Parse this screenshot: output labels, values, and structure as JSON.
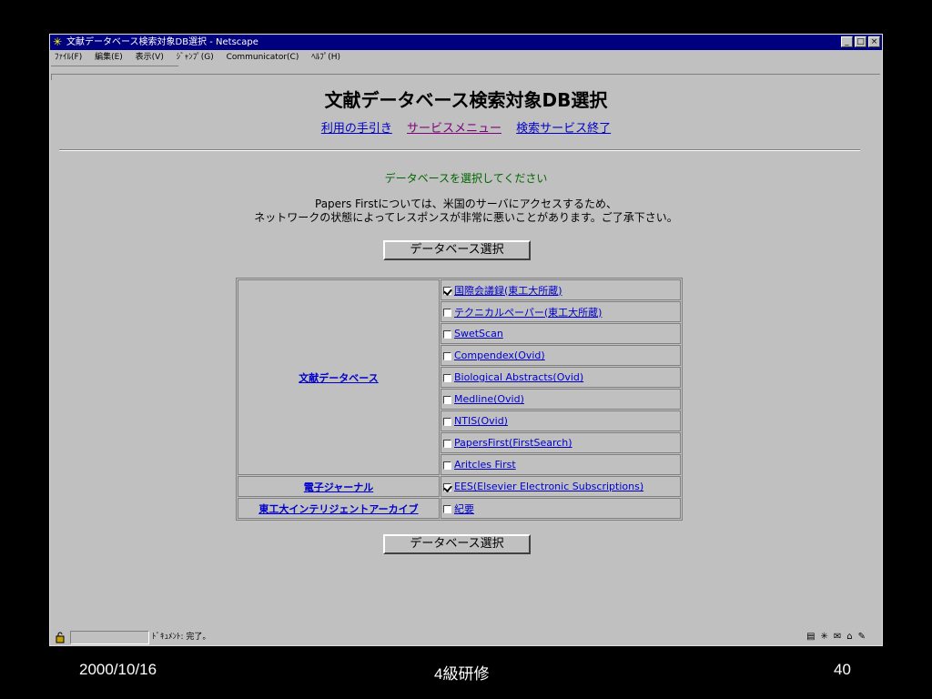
{
  "window": {
    "title": "文献データベース検索対象DB選択 - Netscape",
    "buttons": [
      "_",
      "□",
      "×"
    ]
  },
  "menu": [
    "ﾌｧｲﾙ(F)",
    "編集(E)",
    "表示(V)",
    "ｼﾞｬﾝﾌﾟ(G)",
    "Communicator(C)",
    "ﾍﾙﾌﾟ(H)"
  ],
  "page": {
    "heading": "文献データベース検索対象DB選択",
    "links": [
      "利用の手引き",
      "サービスメニュー",
      "検索サービス終了"
    ],
    "prompt": "データベースを選択してください",
    "notice_line1": "Papers Firstについては、米国のサーバにアクセスするため、",
    "notice_line2": "ネットワークの状態によってレスポンスが非常に悪いことがあります。ご了承下さい。",
    "select_button": "データベース選択"
  },
  "table": {
    "categories": [
      "文献データベース",
      "電子ジャーナル",
      "東工大インテリジェントアーカイブ"
    ],
    "options": [
      {
        "label": "国際会議録(東工大所蔵)",
        "checked": true
      },
      {
        "label": "テクニカルペーパー(東工大所蔵)",
        "checked": false
      },
      {
        "label": "SwetScan",
        "checked": false
      },
      {
        "label": "Compendex(Ovid)",
        "checked": false
      },
      {
        "label": "Biological Abstracts(Ovid)",
        "checked": false
      },
      {
        "label": "Medline(Ovid)",
        "checked": false
      },
      {
        "label": "NTIS(Ovid)",
        "checked": false
      },
      {
        "label": "PapersFirst(FirstSearch)",
        "checked": false
      },
      {
        "label": "Aritcles First",
        "checked": false
      },
      {
        "label": "EES(Elsevier Electronic Subscriptions)",
        "checked": true
      },
      {
        "label": "紀要",
        "checked": false
      }
    ]
  },
  "status": {
    "text": "ﾄﾞｷｭﾒﾝﾄ: 完了。"
  },
  "footer": {
    "date": "2000/10/16",
    "course": "4級研修",
    "page": "40"
  }
}
